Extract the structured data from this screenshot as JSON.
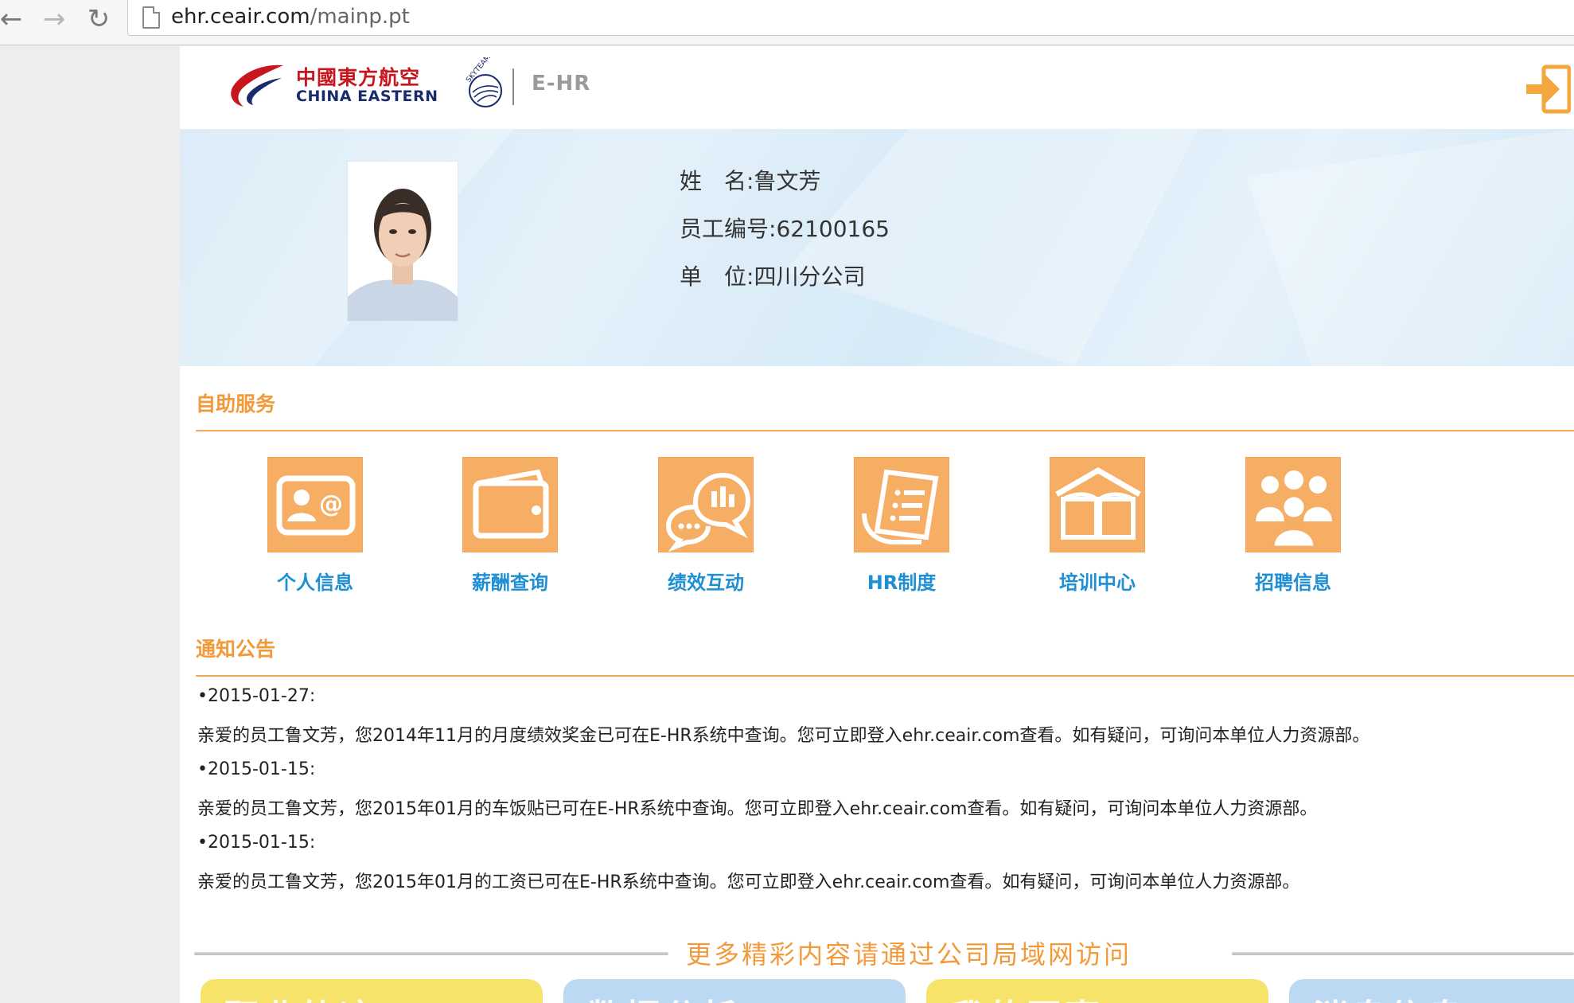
{
  "browser": {
    "url_host": "ehr.ceair.com",
    "url_path": "/mainp.pt"
  },
  "header": {
    "logo_cn": "中國東方航空",
    "logo_en": "CHINA EASTERN",
    "skyteam_text": "SKYTEAM",
    "system_name": "E-HR"
  },
  "profile": {
    "name_label": "姓　名:",
    "name_value": "鲁文芳",
    "id_label": "员工编号:",
    "id_value": "62100165",
    "unit_label": "单　位:",
    "unit_value": "四川分公司"
  },
  "self_service": {
    "title": "自助服务",
    "items": [
      {
        "label": "个人信息",
        "icon": "contact-card-icon"
      },
      {
        "label": "薪酬查询",
        "icon": "wallet-icon"
      },
      {
        "label": "绩效互动",
        "icon": "chat-chart-icon"
      },
      {
        "label": "HR制度",
        "icon": "document-list-icon"
      },
      {
        "label": "培训中心",
        "icon": "open-book-icon"
      },
      {
        "label": "招聘信息",
        "icon": "people-group-icon"
      }
    ]
  },
  "notices": {
    "title": "通知公告",
    "items": [
      {
        "date": "•2015-01-27:",
        "text": "亲爱的员工鲁文芳，您2014年11月的月度绩效奖金已可在E-HR系统中查询。您可立即登入ehr.ceair.com查看。如有疑问，可询问本单位人力资源部。"
      },
      {
        "date": "•2015-01-15:",
        "text": "亲爱的员工鲁文芳，您2015年01月的车饭贴已可在E-HR系统中查询。您可立即登入ehr.ceair.com查看。如有疑问，可询问本单位人力资源部。"
      },
      {
        "date": "•2015-01-15:",
        "text": "亲爱的员工鲁文芳，您2015年01月的工资已可在E-HR系统中查询。您可立即登入ehr.ceair.com查看。如有疑问，可询问本单位人力资源部。"
      }
    ]
  },
  "more": {
    "text": "更多精彩内容请通过公司局域网访问",
    "cards": [
      {
        "label": "职业轨迹",
        "color": "#f7e36a"
      },
      {
        "label": "数据分析",
        "color": "#bcd9f3"
      },
      {
        "label": "我的同事",
        "color": "#f7e36a"
      },
      {
        "label": "消息信息",
        "color": "#bcd9f3"
      }
    ]
  },
  "colors": {
    "accent_orange": "#f29a3a",
    "tile_orange": "#f6ad64",
    "link_blue": "#1f8fd4",
    "brand_red": "#c8161e",
    "brand_navy": "#1a2b6b"
  }
}
